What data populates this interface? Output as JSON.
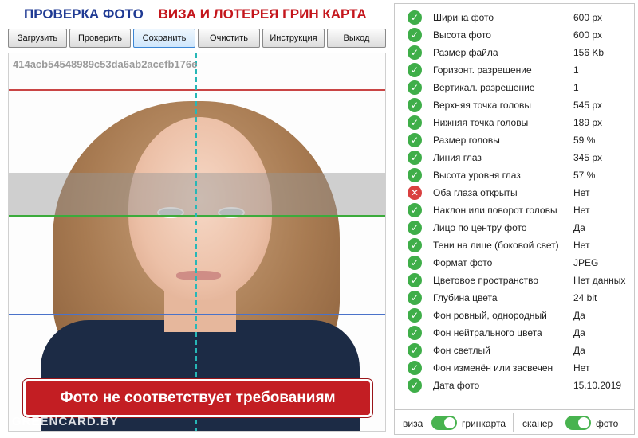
{
  "header": {
    "title_left": "ПРОВЕРКА ФОТО",
    "title_right": "ВИЗА И ЛОТЕРЕЯ ГРИН КАРТА"
  },
  "toolbar": {
    "buttons": [
      "Загрузить",
      "Проверить",
      "Сохранить",
      "Очистить",
      "Инструкция",
      "Выход"
    ],
    "active": "Сохранить"
  },
  "photo": {
    "hash": "414acb54548989c53da6ab2acefb176e",
    "warning": "Фото не соответствует требованиям",
    "watermark": "GREENCARD.BY"
  },
  "checks": [
    {
      "status": "ok",
      "label": "Ширина фото",
      "value": "600 px"
    },
    {
      "status": "ok",
      "label": "Высота фото",
      "value": "600 px"
    },
    {
      "status": "ok",
      "label": "Размер файла",
      "value": "156 Kb"
    },
    {
      "status": "ok",
      "label": "Горизонт. разрешение",
      "value": "1"
    },
    {
      "status": "ok",
      "label": "Вертикал. разрешение",
      "value": "1"
    },
    {
      "status": "ok",
      "label": "Верхняя точка головы",
      "value": "545 px"
    },
    {
      "status": "ok",
      "label": "Нижняя точка головы",
      "value": "189 px"
    },
    {
      "status": "ok",
      "label": "Размер головы",
      "value": "59 %"
    },
    {
      "status": "ok",
      "label": "Линия глаз",
      "value": "345 px"
    },
    {
      "status": "ok",
      "label": "Высота уровня глаз",
      "value": "57 %"
    },
    {
      "status": "bad",
      "label": "Оба глаза открыты",
      "value": "Нет"
    },
    {
      "status": "ok",
      "label": "Наклон или поворот головы",
      "value": "Нет"
    },
    {
      "status": "ok",
      "label": "Лицо по центру фото",
      "value": "Да"
    },
    {
      "status": "ok",
      "label": "Тени на лице (боковой свет)",
      "value": "Нет"
    },
    {
      "status": "ok",
      "label": "Формат фото",
      "value": "JPEG"
    },
    {
      "status": "ok",
      "label": "Цветовое пространство",
      "value": "Нет данных"
    },
    {
      "status": "ok",
      "label": "Глубина цвета",
      "value": "24 bit"
    },
    {
      "status": "ok",
      "label": "Фон ровный, однородный",
      "value": "Да"
    },
    {
      "status": "ok",
      "label": "Фон нейтрального цвета",
      "value": "Да"
    },
    {
      "status": "ok",
      "label": "Фон светлый",
      "value": "Да"
    },
    {
      "status": "ok",
      "label": "Фон изменён или засвечен",
      "value": "Нет"
    },
    {
      "status": "ok",
      "label": "Дата фото",
      "value": "15.10.2019"
    }
  ],
  "footer": {
    "left_off": "виза",
    "left_on": "гринкарта",
    "right_off": "сканер",
    "right_on": "фото"
  },
  "colors": {
    "ok": "#3fae49",
    "bad": "#d94040",
    "toggle": "#48b34f",
    "title_blue": "#1f3a93",
    "title_red": "#c4161c",
    "warning_bg": "#c31e23"
  },
  "icons": {
    "ok": "check-circle-icon",
    "bad": "x-circle-icon"
  }
}
